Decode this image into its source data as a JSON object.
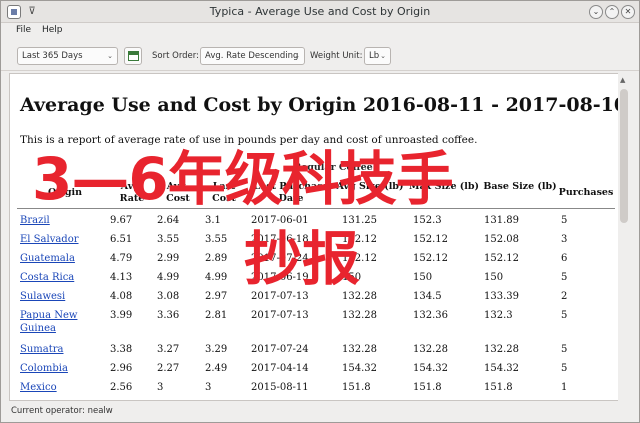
{
  "window": {
    "title": "Typica - Average Use and Cost by Origin",
    "pin_glyph": "⊽",
    "min_glyph": "⌄",
    "max_glyph": "⌃",
    "close_glyph": "✕"
  },
  "menu": {
    "file": "File",
    "help": "Help"
  },
  "toolbar": {
    "range_value": "Last 365 Days",
    "sort_label": "Sort Order:",
    "sort_value": "Avg. Rate Descending",
    "unit_label": "Weight Unit:",
    "unit_value": "Lb",
    "dropdown_arrow": "⌄"
  },
  "report": {
    "title": "Average Use and Cost by Origin 2016-08-11 - 2017-08-10",
    "intro": "This is a report of average rate of use in pounds per day and cost of unroasted coffee.",
    "group_header": "Regular Coffee",
    "columns": {
      "origin": "Origin",
      "avg_rate": "Avg. Rate",
      "avg_cost": "Avg. Cost",
      "last_cost": "Last Cost",
      "last_purchase_date": "Last Purchase Date",
      "avg_size": "Avg Size (lb)",
      "max_size": "Max Size (lb)",
      "base_size": "Base Size (lb)",
      "purchases": "Purchases"
    },
    "rows": [
      {
        "origin": "Brazil",
        "avg_rate": "9.67",
        "avg_cost": "2.64",
        "last_cost": "3.1",
        "date": "2017-06-01",
        "s1": "131.25",
        "s2": "152.3",
        "s3": "131.89",
        "purchases": "5"
      },
      {
        "origin": "El Salvador",
        "avg_rate": "6.51",
        "avg_cost": "3.55",
        "last_cost": "3.55",
        "date": "2017-06-18",
        "s1": "152.12",
        "s2": "152.12",
        "s3": "152.08",
        "purchases": "3"
      },
      {
        "origin": "Guatemala",
        "avg_rate": "4.79",
        "avg_cost": "2.99",
        "last_cost": "2.89",
        "date": "2017-07-24",
        "s1": "152.12",
        "s2": "152.12",
        "s3": "152.12",
        "purchases": "6"
      },
      {
        "origin": "Costa Rica",
        "avg_rate": "4.13",
        "avg_cost": "4.99",
        "last_cost": "4.99",
        "date": "2017-06-19",
        "s1": "150",
        "s2": "150",
        "s3": "150",
        "purchases": "5"
      },
      {
        "origin": "Sulawesi",
        "avg_rate": "4.08",
        "avg_cost": "3.08",
        "last_cost": "2.97",
        "date": "2017-07-13",
        "s1": "132.28",
        "s2": "134.5",
        "s3": "133.39",
        "purchases": "2"
      },
      {
        "origin": "Papua New Guinea",
        "avg_rate": "3.99",
        "avg_cost": "3.36",
        "last_cost": "2.81",
        "date": "2017-07-13",
        "s1": "132.28",
        "s2": "132.36",
        "s3": "132.3",
        "purchases": "5"
      },
      {
        "origin": "Sumatra",
        "avg_rate": "3.38",
        "avg_cost": "3.27",
        "last_cost": "3.29",
        "date": "2017-07-24",
        "s1": "132.28",
        "s2": "132.28",
        "s3": "132.28",
        "purchases": "5"
      },
      {
        "origin": "Colombia",
        "avg_rate": "2.96",
        "avg_cost": "2.27",
        "last_cost": "2.49",
        "date": "2017-04-14",
        "s1": "154.32",
        "s2": "154.32",
        "s3": "154.32",
        "purchases": "5"
      },
      {
        "origin": "Mexico",
        "avg_rate": "2.56",
        "avg_cost": "3",
        "last_cost": "3",
        "date": "2015-08-11",
        "s1": "151.8",
        "s2": "151.8",
        "s3": "151.8",
        "purchases": "1"
      }
    ]
  },
  "status": {
    "text": "Current operator: nealw"
  },
  "overlay": {
    "line1": "3—6年级科技手",
    "line2": "抄报"
  }
}
